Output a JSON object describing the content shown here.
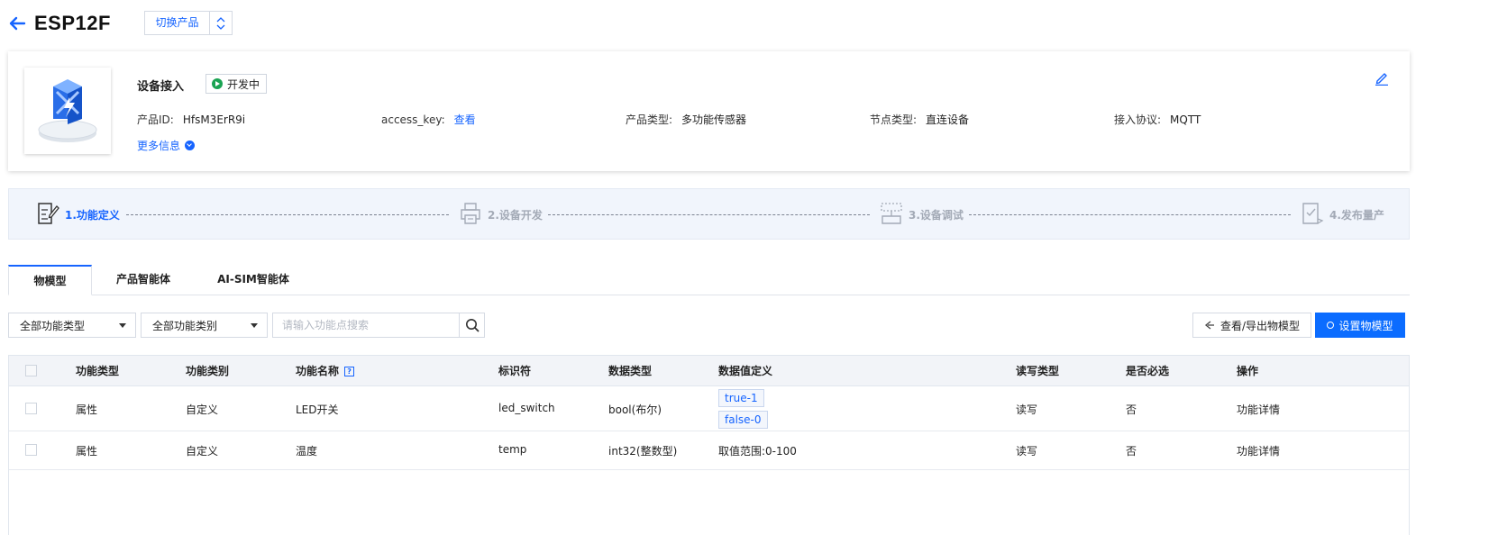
{
  "header": {
    "title": "ESP12F",
    "switch_label": "切换产品"
  },
  "product": {
    "title": "设备接入",
    "status": "开发中",
    "fields": [
      {
        "label": "产品ID:",
        "value": "HfsM3ErR9i"
      },
      {
        "label": "access_key:",
        "value": "查看"
      },
      {
        "label": "产品类型:",
        "value": "多功能传感器"
      },
      {
        "label": "节点类型:",
        "value": "直连设备"
      },
      {
        "label": "接入协议:",
        "value": "MQTT"
      }
    ],
    "more_info": "更多信息"
  },
  "steps": [
    {
      "label": "1.功能定义",
      "state": "active"
    },
    {
      "label": "2.设备开发",
      "state": "inactive"
    },
    {
      "label": "3.设备调试",
      "state": "inactive"
    },
    {
      "label": "4.发布量产",
      "state": "inactive"
    }
  ],
  "tabs": [
    {
      "label": "物模型",
      "active": true
    },
    {
      "label": "产品智能体",
      "active": false
    },
    {
      "label": "AI-SIM智能体",
      "active": false
    }
  ],
  "filters": {
    "type_select": "全部功能类型",
    "category_select": "全部功能类别",
    "search_placeholder": "请输入功能点搜索"
  },
  "actions": {
    "view_export": "查看/导出物模型",
    "setup_model": "设置物模型"
  },
  "table": {
    "headers": [
      "功能类型",
      "功能类别",
      "功能名称",
      "标识符",
      "数据类型",
      "数据值定义",
      "读写类型",
      "是否必选",
      "操作"
    ],
    "rows": [
      {
        "type": "属性",
        "category": "自定义",
        "name": "LED开关",
        "identifier": "led_switch",
        "data_type": "bool(布尔)",
        "definition_tags": [
          "true-1",
          "false-0"
        ],
        "rw": "读写",
        "required": "否",
        "action": "功能详情"
      },
      {
        "type": "属性",
        "category": "自定义",
        "name": "温度",
        "identifier": "temp",
        "data_type": "int32(整数型)",
        "definition_text": "取值范围:0-100",
        "rw": "读写",
        "required": "否",
        "action": "功能详情"
      }
    ]
  },
  "colors": {
    "accent": "#1664ff",
    "primary_button": "#0b6cff",
    "status_green": "#1aa352",
    "steps_background": "#f1f5fc",
    "table_header_background": "#f2f4f8"
  },
  "icons": {
    "back": "arrow-left-icon",
    "switch": "chevron-up-down-icon",
    "edit": "pencil-icon",
    "search": "search-icon"
  }
}
